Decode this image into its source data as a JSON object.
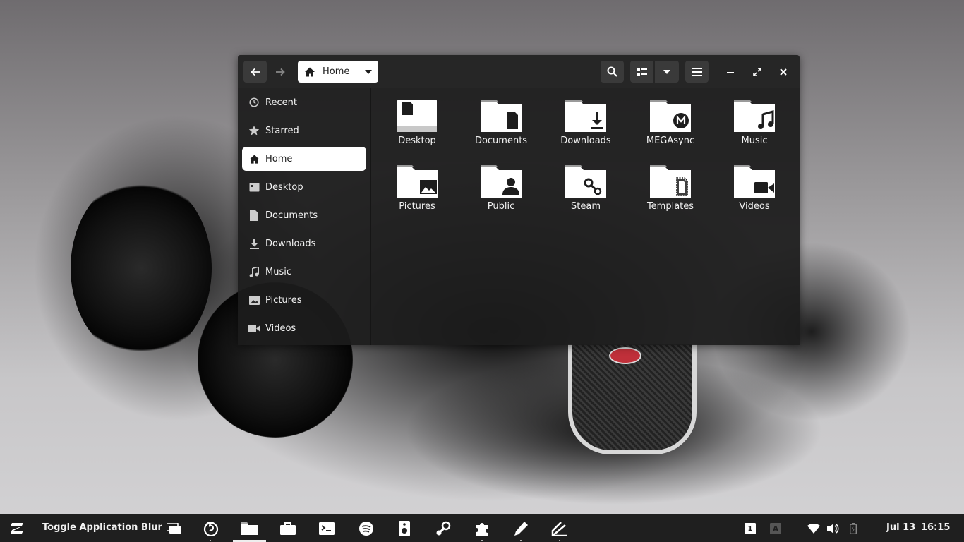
{
  "window": {
    "path_label": "Home",
    "sidebar": [
      {
        "label": "Recent",
        "icon": "clock-icon"
      },
      {
        "label": "Starred",
        "icon": "star-icon"
      },
      {
        "label": "Home",
        "icon": "home-icon"
      },
      {
        "label": "Desktop",
        "icon": "desktop-icon"
      },
      {
        "label": "Documents",
        "icon": "document-icon"
      },
      {
        "label": "Downloads",
        "icon": "download-icon"
      },
      {
        "label": "Music",
        "icon": "music-icon"
      },
      {
        "label": "Pictures",
        "icon": "picture-icon"
      },
      {
        "label": "Videos",
        "icon": "video-icon"
      }
    ],
    "active_sidebar": "Home",
    "folders": [
      {
        "label": "Desktop",
        "icon": "desktop-folder-icon"
      },
      {
        "label": "Documents",
        "icon": "documents-folder-icon"
      },
      {
        "label": "Downloads",
        "icon": "downloads-folder-icon"
      },
      {
        "label": "MEGAsync",
        "icon": "megasync-folder-icon"
      },
      {
        "label": "Music",
        "icon": "music-folder-icon"
      },
      {
        "label": "Pictures",
        "icon": "pictures-folder-icon"
      },
      {
        "label": "Public",
        "icon": "public-folder-icon"
      },
      {
        "label": "Steam",
        "icon": "steam-folder-icon"
      },
      {
        "label": "Templates",
        "icon": "templates-folder-icon"
      },
      {
        "label": "Videos",
        "icon": "videos-folder-icon"
      }
    ]
  },
  "taskbar": {
    "active_app_title": "Toggle Application Blur",
    "date": "Jul 13",
    "time": "16:15",
    "workspace": "1",
    "keyboard_layout": "A"
  },
  "colors": {
    "window_bg": "#1c1c1c",
    "headerbar": "#262626",
    "button": "#3a3a3a",
    "selection": "#ffffff",
    "taskbar": "#1f1f1f"
  }
}
